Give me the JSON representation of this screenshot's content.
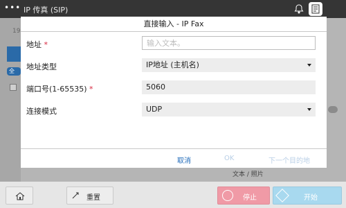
{
  "topbar": {
    "menu_icon": "ellipsis-icon",
    "title": "IP 传真 (SIP)",
    "bell_icon": "bell-icon",
    "task_icon": "task-icon"
  },
  "background": {
    "number": "19",
    "pill_label": "全",
    "doc_text_partial": "...",
    "doc_text": "文本 / 照片"
  },
  "dialog": {
    "title": "直接输入 - IP Fax",
    "fields": {
      "address": {
        "label": "地址",
        "required": "*",
        "placeholder": "输入文本。"
      },
      "address_type": {
        "label": "地址类型",
        "value": "IP地址 (主机名)"
      },
      "port": {
        "label": "端口号(1-65535)",
        "required": "*",
        "value": "5060"
      },
      "connection_mode": {
        "label": "连接模式",
        "value": "UDP"
      }
    },
    "footer": {
      "cancel": "取消",
      "ok": "OK",
      "next": "下一个目的地"
    }
  },
  "bottom": {
    "home_icon": "home-icon",
    "reset_icon": "reset-icon",
    "reset_label": "重置",
    "stop_icon": "stop-icon",
    "stop_label": "停止",
    "start_icon": "start-icon",
    "start_label": "开始"
  },
  "colors": {
    "accent": "#1e69b9",
    "required": "#d7263d",
    "stop": "#f09aa6",
    "start": "#a8d9ef",
    "topbar": "#353535"
  }
}
